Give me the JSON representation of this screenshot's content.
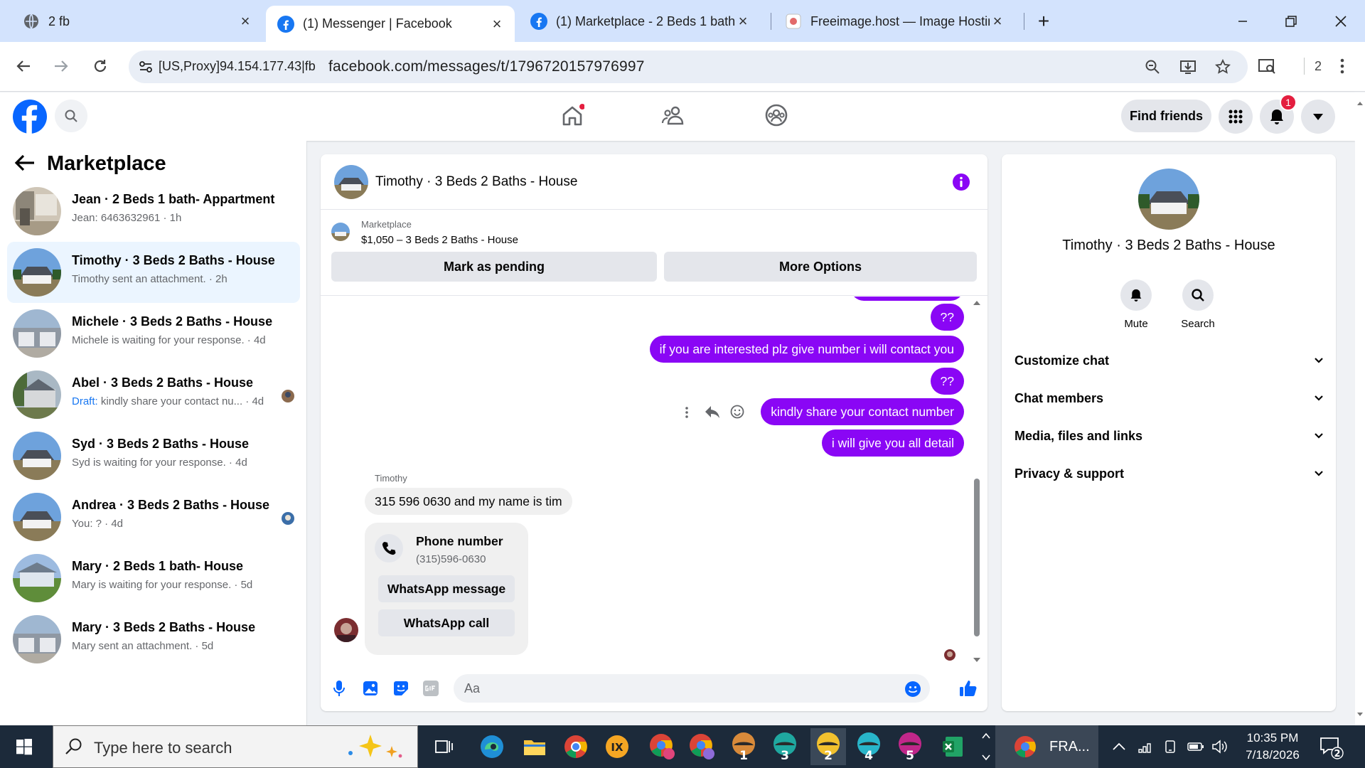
{
  "browser": {
    "tabs": [
      {
        "title": "2 fb",
        "active": false
      },
      {
        "title": "(1) Messenger | Facebook",
        "active": true
      },
      {
        "title": "(1) Marketplace - 2 Beds 1 bath",
        "active": false
      },
      {
        "title": "Freeimage.host — Image Hosting",
        "active": false
      }
    ],
    "site_label": "[US,Proxy]94.154.177.43|fb",
    "url": "facebook.com/messages/t/1796720157976997",
    "profile_count": "2"
  },
  "fb_header": {
    "find_friends_label": "Find friends",
    "notification_count": "1"
  },
  "sidebar": {
    "title": "Marketplace",
    "conversations": [
      {
        "name": "Jean · 2 Beds 1 bath- Appartment",
        "draft_prefix": "",
        "preview": "Jean: 6463632961 · 1h",
        "selected": false
      },
      {
        "name": "Timothy · 3 Beds 2 Baths - House",
        "draft_prefix": "",
        "preview": "Timothy sent an attachment. · 2h",
        "selected": true
      },
      {
        "name": "Michele · 3 Beds 2 Baths - House",
        "draft_prefix": "",
        "preview": "Michele is waiting for your response. · 4d",
        "selected": false
      },
      {
        "name": "Abel · 3 Beds 2 Baths - House",
        "draft_prefix": "Draft:",
        "preview": " kindly share your contact nu... · 4d",
        "selected": false
      },
      {
        "name": "Syd · 3 Beds 2 Baths - House",
        "draft_prefix": "",
        "preview": "Syd is waiting for your response. · 4d",
        "selected": false
      },
      {
        "name": "Andrea · 3 Beds 2 Baths - House",
        "draft_prefix": "",
        "preview": "You: ? · 4d",
        "selected": false
      },
      {
        "name": "Mary · 2 Beds 1 bath- House",
        "draft_prefix": "",
        "preview": "Mary is waiting for your response. · 5d",
        "selected": false
      },
      {
        "name": "Mary · 3 Beds 2 Baths - House",
        "draft_prefix": "",
        "preview": "Mary sent an attachment. · 5d",
        "selected": false
      }
    ]
  },
  "chat": {
    "title": "Timothy · 3 Beds 2 Baths - House",
    "listing": {
      "label": "Marketplace",
      "price_title": "$1,050 – 3 Beds 2 Baths - House",
      "mark_pending_label": "Mark as pending",
      "more_options_label": "More Options"
    },
    "outgoing": [
      "??",
      "if you are interested plz give number i will contact you",
      "??",
      "kindly share your contact number",
      "i will give you all detail"
    ],
    "sender_name": "Timothy",
    "incoming_text": "315 596 0630  and my name is tim",
    "phone_card": {
      "title": "Phone number",
      "number": "(315)596-0630",
      "whatsapp_message_label": "WhatsApp message",
      "whatsapp_call_label": "WhatsApp call"
    },
    "composer_placeholder": "Aa",
    "accent_color": "#8a06f5"
  },
  "info_panel": {
    "title": "Timothy · 3 Beds 2 Baths - House",
    "mute_label": "Mute",
    "search_label": "Search",
    "sections": [
      "Customize chat",
      "Chat members",
      "Media, files and links",
      "Privacy & support"
    ]
  },
  "taskbar": {
    "search_placeholder": "Type here to search",
    "tray_app_label": "FRA...",
    "time": "10:35 PM",
    "date": "7/18/2026",
    "notification_count": "2",
    "numbered_apps": [
      "1",
      "3",
      "2",
      "4",
      "5"
    ]
  }
}
